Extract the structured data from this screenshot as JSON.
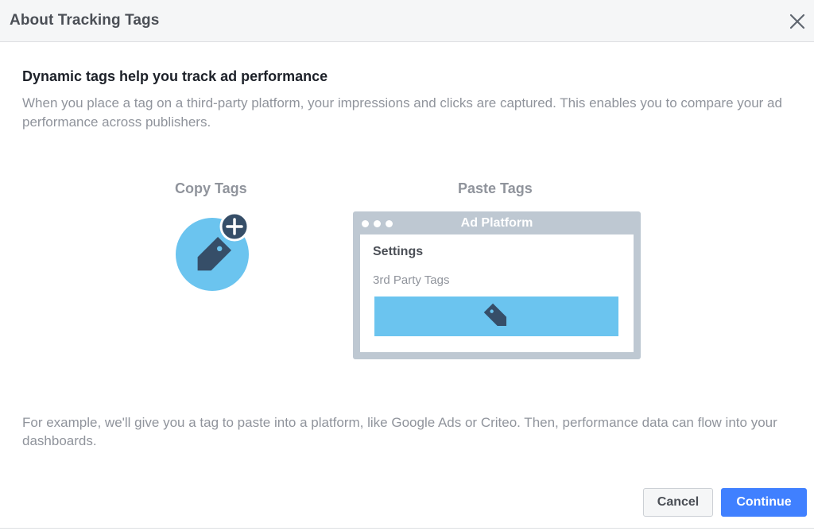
{
  "dialog": {
    "title": "About Tracking Tags",
    "heading": "Dynamic tags help you track ad performance",
    "description": "When you place a tag on a third-party platform, your impressions and clicks are captured. This enables you to compare your ad performance across publishers.",
    "example": "For example, we'll give you a tag to paste into a platform, like Google Ads or Criteo. Then, performance data can flow into your dashboards."
  },
  "illustration": {
    "copy_label": "Copy Tags",
    "paste_label": "Paste Tags",
    "platform_title": "Ad Platform",
    "settings_label": "Settings",
    "third_party_label": "3rd Party Tags"
  },
  "buttons": {
    "cancel": "Cancel",
    "continue": "Continue"
  },
  "icons": {
    "close": "close-icon",
    "tag": "tag-icon",
    "plus": "plus-icon"
  },
  "colors": {
    "accent": "#4080ff",
    "tag_blue": "#6bc4ef",
    "tag_dark": "#364e68",
    "platform_frame": "#bec8d2"
  }
}
